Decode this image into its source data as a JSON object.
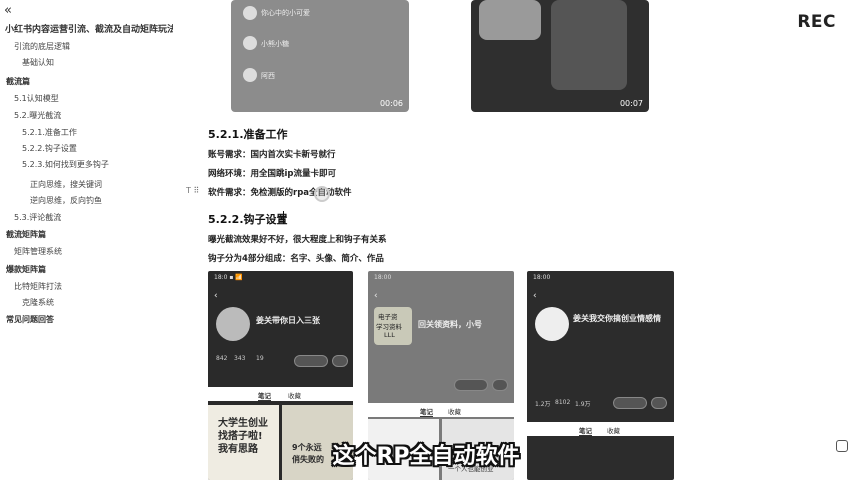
{
  "sidebar": {
    "collapse_glyph": "«",
    "doc_title": "小红书内容运营引流、截流及自动矩阵玩法",
    "items": [
      {
        "label": "引流的底层逻辑",
        "level": 2
      },
      {
        "label": "基础认知",
        "level": 3
      },
      {
        "label": "截流篇",
        "level": 1
      },
      {
        "label": "5.1认知模型",
        "level": 2
      },
      {
        "label": "5.2.曝光截流",
        "level": 2
      },
      {
        "label": "5.2.1.准备工作",
        "level": 3
      },
      {
        "label": "5.2.2.钩子设置",
        "level": 3
      },
      {
        "label": "5.2.3.如何找到更多钩子",
        "level": 3
      },
      {
        "label": "正向思维，搜关键词",
        "level": 4
      },
      {
        "label": "逆向思维，反向钓鱼",
        "level": 4
      },
      {
        "label": "5.3.评论截流",
        "level": 2
      },
      {
        "label": "截流矩阵篇",
        "level": 1
      },
      {
        "label": "矩阵管理系统",
        "level": 2
      },
      {
        "label": "爆款矩阵篇",
        "level": 1
      },
      {
        "label": "比特矩阵打法",
        "level": 2
      },
      {
        "label": "克隆系统",
        "level": 2
      },
      {
        "label": "常见问题回答",
        "level": 1
      }
    ]
  },
  "thumbs": [
    {
      "duration": "00:06",
      "lines": [
        "你心中的小可爱",
        "小熊小糖",
        "阿西"
      ]
    },
    {
      "duration": "00:07"
    }
  ],
  "content": {
    "h_521": "5.2.1.准备工作",
    "lines_521": [
      "账号需求：国内首次实卡新号就行",
      "网络环境：用全国跳ip流量卡即可",
      "软件需求：免检测版的rpa全自动软件"
    ],
    "h_522": "5.2.2.钩子设置",
    "lines_522": [
      "曝光截流效果好不好，很大程度上和钩子有关系",
      "钩子分为4部分组成：名字、头像、简介、作品"
    ],
    "t_handle": "T ⠿"
  },
  "phones": [
    {
      "status": "18:0 ▪ 📶",
      "name": "姜关带你日入三张",
      "stats": [
        "842",
        "343",
        "19"
      ],
      "tab_active": "笔记",
      "tab_other": "收藏",
      "post_left": [
        "大学生创业",
        "找搭子啦!",
        "我有思路"
      ],
      "post_right": [
        "9个永远",
        "俏失败的"
      ]
    },
    {
      "status": "18:00",
      "avatar_text": [
        "电子资",
        "学习资料",
        "LLL"
      ],
      "name": "回关领资料，小号",
      "tab_active": "笔记",
      "tab_other": "收藏",
      "post_right": [
        "一个人也能创业"
      ]
    },
    {
      "status": "18:00",
      "name": "姜关我交你搞创业情感情",
      "stats": [
        "1.2万",
        "8102",
        "1.9万"
      ],
      "tab_active": "笔记",
      "tab_other": "收藏"
    }
  ],
  "rec_label": "REC",
  "subtitle": "这个RP全自动软件",
  "colors": {
    "accent": "#222222",
    "sidebar_text": "#444444",
    "subtitle_stroke": "#111111"
  }
}
